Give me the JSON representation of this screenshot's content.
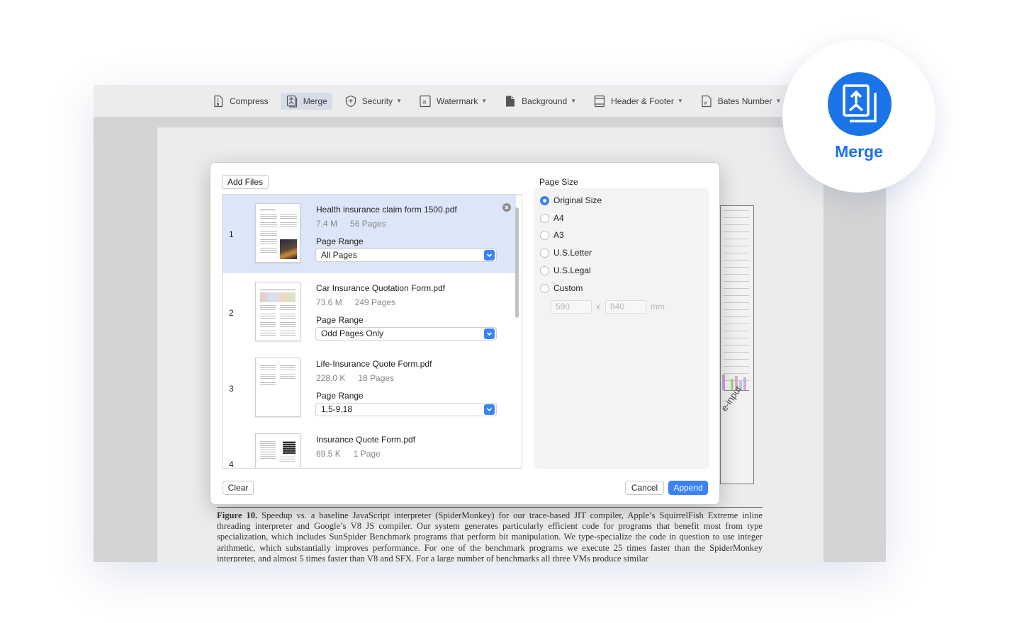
{
  "toolbar": {
    "items": [
      {
        "label": "Compress",
        "icon": "compress-icon",
        "dropdown": false
      },
      {
        "label": "Merge",
        "icon": "merge-icon",
        "dropdown": false,
        "active": true
      },
      {
        "label": "Security",
        "icon": "shield-icon",
        "dropdown": true
      },
      {
        "label": "Watermark",
        "icon": "watermark-icon",
        "dropdown": true
      },
      {
        "label": "Background",
        "icon": "background-icon",
        "dropdown": true
      },
      {
        "label": "Header & Footer",
        "icon": "header-footer-icon",
        "dropdown": true
      },
      {
        "label": "Bates Number",
        "icon": "bates-number-icon",
        "dropdown": true
      }
    ]
  },
  "document": {
    "chart_label": "e-input",
    "caption_lead": "Figure 10.",
    "caption_text": "Speedup vs. a baseline JavaScript interpreter (SpiderMonkey) for our trace-based JIT compiler, Apple’s SquirrelFish Extreme inline threading interpreter and Google’s V8 JS compiler. Our system generates particularly efficient code for programs that benefit most from type specialization, which includes SunSpider Benchmark programs that perform bit manipulation. We type-specialize the code in question to use integer arithmetic, which substantially improves performance. For one of the benchmark programs we execute 25 times faster than the SpiderMonkey interpreter, and almost 5 times faster than V8 and SFX. For a large number of benchmarks all three VMs produce similar"
  },
  "dialog": {
    "add_files_label": "Add Files",
    "clear_label": "Clear",
    "cancel_label": "Cancel",
    "append_label": "Append",
    "page_range_label": "Page Range",
    "files": [
      {
        "index": "1",
        "name": "Health insurance claim form 1500.pdf",
        "size": "7.4 M",
        "pages": "56 Pages",
        "range": "All Pages",
        "selected": true
      },
      {
        "index": "2",
        "name": "Car Insurance Quotation Form.pdf",
        "size": "73.6 M",
        "pages": "249 Pages",
        "range": "Odd Pages Only"
      },
      {
        "index": "3",
        "name": "Life-Insurance Quote Form.pdf",
        "size": "228.0 K",
        "pages": "18 Pages",
        "range": "1,5-9,18"
      },
      {
        "index": "4",
        "name": "Insurance Quote Form.pdf",
        "size": "69.5 K",
        "pages": "1 Page",
        "range": ""
      }
    ],
    "page_size": {
      "title": "Page Size",
      "options": [
        "Original Size",
        "A4",
        "A3",
        "U.S.Letter",
        "U.S.Legal",
        "Custom"
      ],
      "selected": "Original Size",
      "custom_width": "590",
      "custom_height": "840",
      "separator": "x",
      "unit": "mm"
    }
  },
  "badge": {
    "label": "Merge",
    "icon": "merge-icon",
    "color": "#1b73e8"
  },
  "colors": {
    "accent": "#3a82f7",
    "selected_row": "#dce6f8",
    "brand": "#1b73e8"
  }
}
